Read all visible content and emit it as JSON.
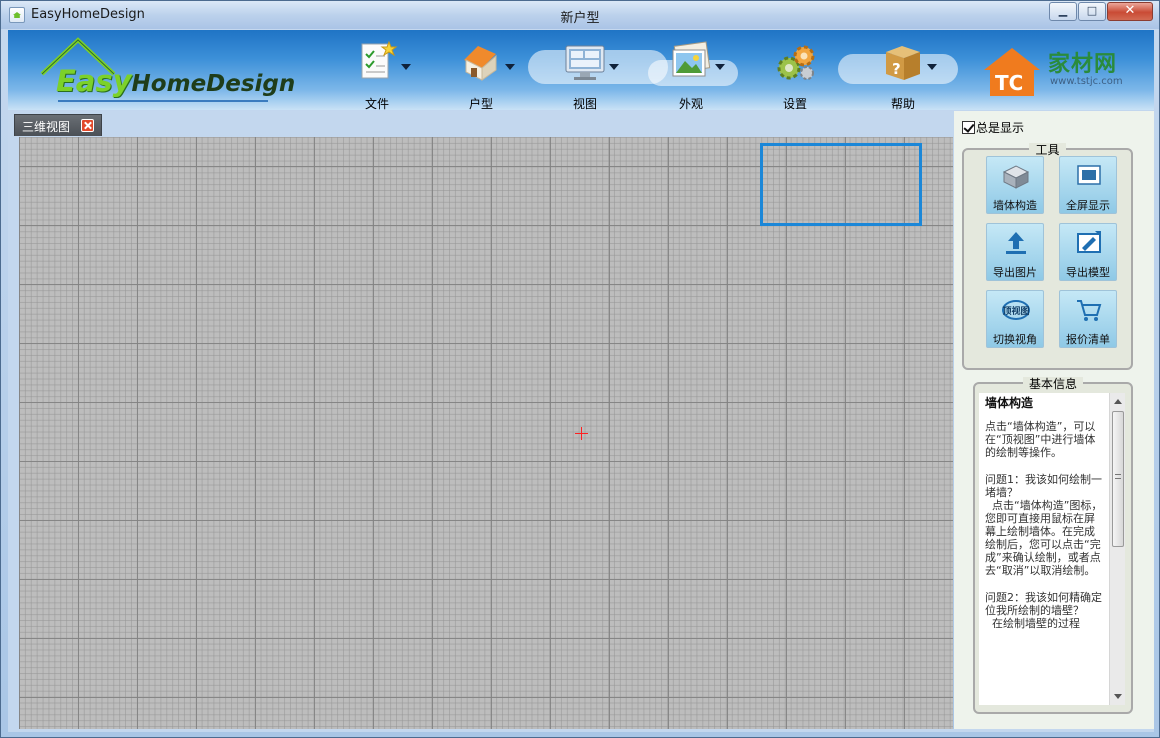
{
  "window": {
    "app_name": "EasyHomeDesign",
    "document_title": "新户型",
    "minimize_glyph": "▁",
    "maximize_glyph": "□",
    "close_glyph": "✕"
  },
  "logo": {
    "easy": "Easy",
    "home": "HomeDesign"
  },
  "toolbar": {
    "items": [
      {
        "label": "文件",
        "icon": "file-checklist-icon"
      },
      {
        "label": "户型",
        "icon": "house-icon"
      },
      {
        "label": "视图",
        "icon": "monitor-icon"
      },
      {
        "label": "外观",
        "icon": "picture-icon"
      },
      {
        "label": "设置",
        "icon": "gears-icon"
      },
      {
        "label": "帮助",
        "icon": "help-box-icon"
      }
    ]
  },
  "brand": {
    "name": "家材网",
    "url": "www.tstjc.com",
    "mark": "TC"
  },
  "tabs": [
    {
      "label": "三维视图"
    }
  ],
  "right_panel": {
    "always_show_label": "总是显示",
    "always_show_checked": true,
    "tools_title": "工具",
    "tools": [
      {
        "label": "墙体构造",
        "icon": "wall-icon"
      },
      {
        "label": "全屏显示",
        "icon": "fullscreen-icon"
      },
      {
        "label": "导出图片",
        "icon": "export-image-icon"
      },
      {
        "label": "导出模型",
        "icon": "export-model-icon"
      },
      {
        "label": "切换视角",
        "icon": "top-view-icon",
        "icon_text": "顶视图"
      },
      {
        "label": "报价清单",
        "icon": "cart-icon"
      }
    ],
    "info_title": "基本信息",
    "info": {
      "heading": "墙体构造",
      "paragraphs": [
        "点击“墙体构造”，可以在“顶视图”中进行墙体的绘制等操作。",
        "问题1：我该如何绘制一堵墙？\n  点击“墙体构造”图标，您即可直接用鼠标在屏幕上绘制墙体。在完成绘制后，您可以点击“完成”来确认绘制，或者点去“取消”以取消绘制。",
        "问题2：我该如何精确定位我所绘制的墙壁？\n  在绘制墙壁的过程"
      ]
    }
  },
  "colors": {
    "accent": "#1b87d8",
    "tab_bg": "#50555b",
    "crosshair": "#ff2020",
    "canvas_bg": "#bdbdbd"
  }
}
